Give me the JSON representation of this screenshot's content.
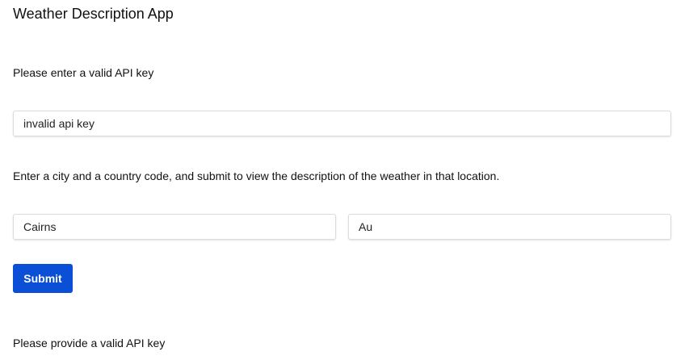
{
  "app": {
    "title": "Weather Description App"
  },
  "api_key": {
    "label": "Please enter a valid API key",
    "value": "invalid api key"
  },
  "location": {
    "instructions": "Enter a city and a country code, and submit to view the description of the weather in that location.",
    "city_value": "Cairns",
    "country_value": "Au"
  },
  "actions": {
    "submit_label": "Submit",
    "submit_color": "#0a4fd6"
  },
  "status": {
    "message": "Please provide a valid API key"
  }
}
